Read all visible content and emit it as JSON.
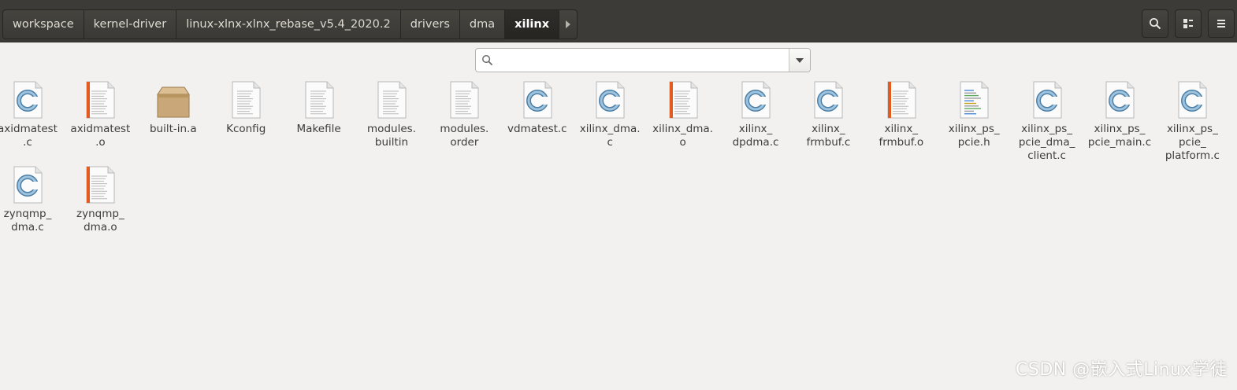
{
  "breadcrumbs": [
    "workspace",
    "kernel-driver",
    "linux-xlnx-xlnx_rebase_v5.4_2020.2",
    "drivers",
    "dma",
    "xilinx"
  ],
  "active_crumb_index": 5,
  "search": {
    "placeholder": ""
  },
  "colors": {
    "headerbar": "#3c3b37",
    "background": "#f2f1f0",
    "c_icon": "#5b8fb5",
    "o_icon": "#e05a1d"
  },
  "files": [
    {
      "name": "axidmatest.c",
      "label": "axidmatest\n.c",
      "type": "c"
    },
    {
      "name": "axidmatest.o",
      "label": "axidmatest\n.o",
      "type": "o"
    },
    {
      "name": "built-in.a",
      "label": "built-in.a",
      "type": "archive"
    },
    {
      "name": "Kconfig",
      "label": "Kconfig",
      "type": "text"
    },
    {
      "name": "Makefile",
      "label": "Makefile",
      "type": "text"
    },
    {
      "name": "modules.builtin",
      "label": "modules.\nbuiltin",
      "type": "text"
    },
    {
      "name": "modules.order",
      "label": "modules.\norder",
      "type": "text"
    },
    {
      "name": "vdmatest.c",
      "label": "vdmatest.c",
      "type": "c"
    },
    {
      "name": "xilinx_dma.c",
      "label": "xilinx_dma.\nc",
      "type": "c"
    },
    {
      "name": "xilinx_dma.o",
      "label": "xilinx_dma.\no",
      "type": "o"
    },
    {
      "name": "xilinx_dpdma.c",
      "label": "xilinx_\ndpdma.c",
      "type": "c"
    },
    {
      "name": "xilinx_frmbuf.c",
      "label": "xilinx_\nfrmbuf.c",
      "type": "c"
    },
    {
      "name": "xilinx_frmbuf.o",
      "label": "xilinx_\nfrmbuf.o",
      "type": "o"
    },
    {
      "name": "xilinx_ps_pcie.h",
      "label": "xilinx_ps_\npcie.h",
      "type": "h"
    },
    {
      "name": "xilinx_ps_pcie_dma_client.c",
      "label": "xilinx_ps_\npcie_dma_\nclient.c",
      "type": "c"
    },
    {
      "name": "xilinx_ps_pcie_main.c",
      "label": "xilinx_ps_\npcie_main.c",
      "type": "c"
    },
    {
      "name": "xilinx_ps_pcie_platform.c",
      "label": "xilinx_ps_\npcie_\nplatform.c",
      "type": "c"
    },
    {
      "name": "zynqmp_dma.c",
      "label": "zynqmp_\ndma.c",
      "type": "c"
    },
    {
      "name": "zynqmp_dma.o",
      "label": "zynqmp_\ndma.o",
      "type": "o"
    }
  ],
  "icons": {
    "search": "search-icon",
    "view": "list-view-icon",
    "menu": "hamburger-menu-icon"
  },
  "watermark": "CSDN @嵌入式Linux学徒"
}
